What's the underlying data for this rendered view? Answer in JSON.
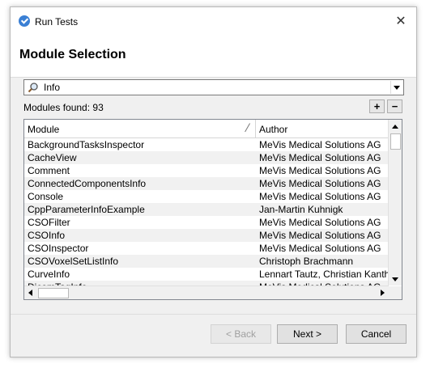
{
  "window": {
    "title": "Run Tests",
    "close_glyph": "✕",
    "app_icon": "run-tests-icon"
  },
  "page": {
    "heading": "Module Selection"
  },
  "filter": {
    "value": "Info",
    "icon": "magnifier-icon"
  },
  "modules_found": "Modules found: 93",
  "list_controls": {
    "add": "+",
    "remove": "−"
  },
  "table": {
    "columns": [
      "Module",
      "Author"
    ],
    "rows": [
      {
        "module": "BackgroundTasksInspector",
        "author": "MeVis Medical Solutions AG"
      },
      {
        "module": "CacheView",
        "author": "MeVis Medical Solutions AG"
      },
      {
        "module": "Comment",
        "author": "MeVis Medical Solutions AG"
      },
      {
        "module": "ConnectedComponentsInfo",
        "author": "MeVis Medical Solutions AG"
      },
      {
        "module": "Console",
        "author": "MeVis Medical Solutions AG"
      },
      {
        "module": "CppParameterInfoExample",
        "author": "Jan-Martin Kuhnigk"
      },
      {
        "module": "CSOFilter",
        "author": "MeVis Medical Solutions AG"
      },
      {
        "module": "CSOInfo",
        "author": "MeVis Medical Solutions AG"
      },
      {
        "module": "CSOInspector",
        "author": "MeVis Medical Solutions AG"
      },
      {
        "module": "CSOVoxelSetListInfo",
        "author": "Christoph Brachmann"
      },
      {
        "module": "CurveInfo",
        "author": "Lennart Tautz, Christian Kanthak"
      },
      {
        "module": "DicomTagInfo",
        "author": "MeVis Medical Solutions AG"
      }
    ]
  },
  "buttons": {
    "back": "< Back",
    "next": "Next >",
    "cancel": "Cancel"
  }
}
